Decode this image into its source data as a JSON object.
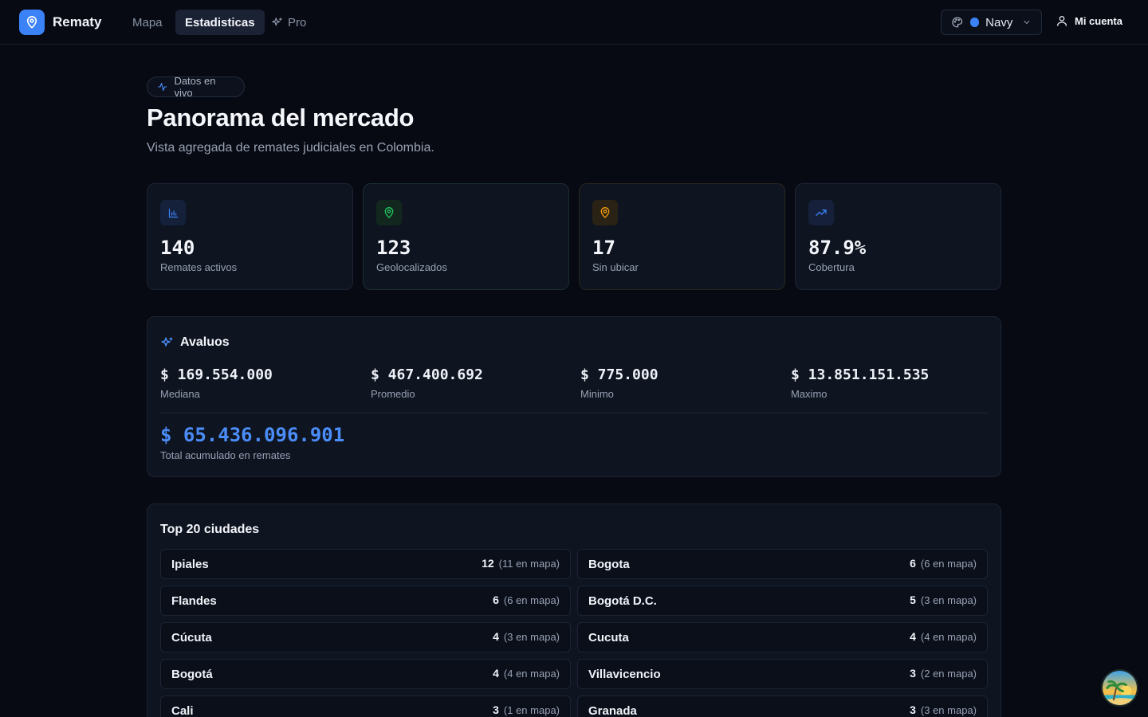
{
  "app": {
    "brand": "Rematy"
  },
  "nav": {
    "items": [
      "Mapa",
      "Estadisticas",
      "Pro"
    ],
    "active": "Estadisticas"
  },
  "theme": {
    "label": "Navy",
    "accent": "#3b82f6"
  },
  "account": {
    "label": "Mi cuenta"
  },
  "hero": {
    "badge": "Datos en vivo",
    "title": "Panorama del mercado",
    "subtitle": "Vista agregada de remates judiciales en Colombia."
  },
  "stats": [
    {
      "value": "140",
      "label": "Remates activos",
      "icon": "bar-chart-icon",
      "color": "#3b82f6"
    },
    {
      "value": "123",
      "label": "Geolocalizados",
      "icon": "map-pin-icon",
      "color": "#22c55e"
    },
    {
      "value": "17",
      "label": "Sin ubicar",
      "icon": "map-pin-icon",
      "color": "#f59e0b"
    },
    {
      "value": "87.9%",
      "label": "Cobertura",
      "icon": "trending-up-icon",
      "color": "#3b82f6"
    }
  ],
  "avaluos": {
    "title": "Avaluos",
    "items": [
      {
        "value": "$ 169.554.000",
        "label": "Mediana"
      },
      {
        "value": "$ 467.400.692",
        "label": "Promedio"
      },
      {
        "value": "$ 775.000",
        "label": "Minimo"
      },
      {
        "value": "$ 13.851.151.535",
        "label": "Maximo"
      }
    ],
    "total_value": "$ 65.436.096.901",
    "total_label": "Total acumulado en remates"
  },
  "cities": {
    "title": "Top 20 ciudades",
    "left": [
      {
        "name": "Ipiales",
        "count": "12",
        "map": "(11 en mapa)"
      },
      {
        "name": "Flandes",
        "count": "6",
        "map": "(6 en mapa)"
      },
      {
        "name": "Cúcuta",
        "count": "4",
        "map": "(3 en mapa)"
      },
      {
        "name": "Bogotá",
        "count": "4",
        "map": "(4 en mapa)"
      },
      {
        "name": "Cali",
        "count": "3",
        "map": "(1 en mapa)"
      }
    ],
    "right": [
      {
        "name": "Bogota",
        "count": "6",
        "map": "(6 en mapa)"
      },
      {
        "name": "Bogotá D.C.",
        "count": "5",
        "map": "(3 en mapa)"
      },
      {
        "name": "Cucuta",
        "count": "4",
        "map": "(4 en mapa)"
      },
      {
        "name": "Villavicencio",
        "count": "3",
        "map": "(2 en mapa)"
      },
      {
        "name": "Granada",
        "count": "3",
        "map": "(3 en mapa)"
      }
    ]
  }
}
